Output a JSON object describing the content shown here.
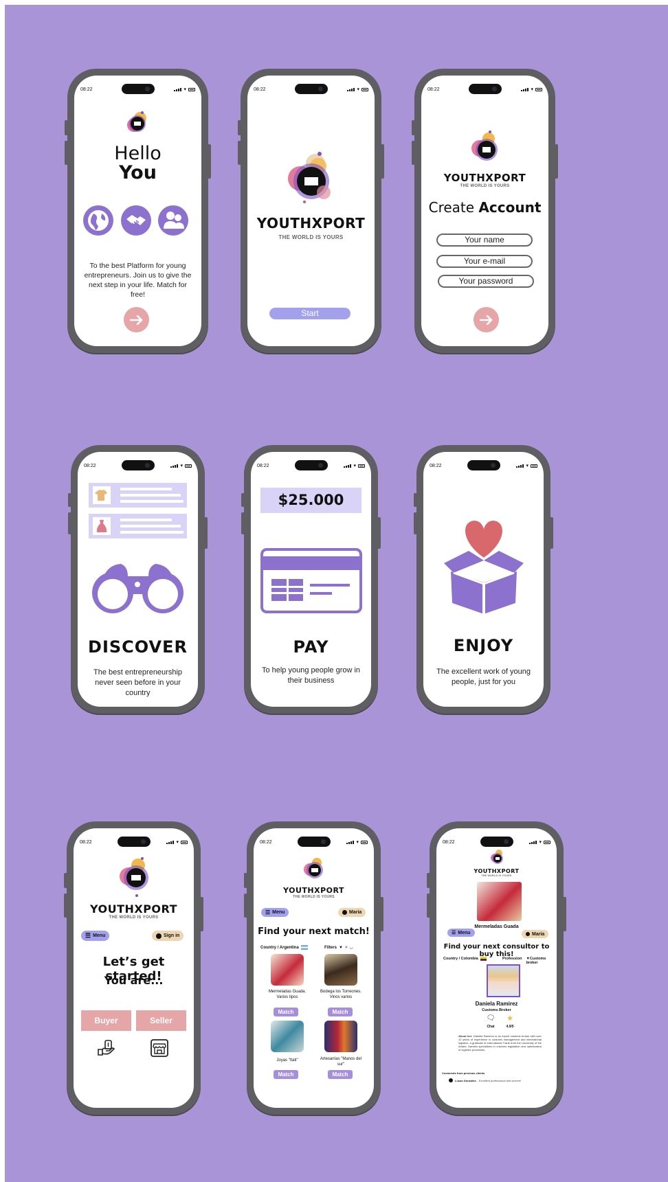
{
  "status_time": "08:22",
  "colors": {
    "background": "#a994d8",
    "purple": "#8d71cf",
    "light_purple": "#d9d4f7",
    "pink": "#e6a5a7",
    "gold": "#edd6b1"
  },
  "icons": [
    "logo-icon",
    "globe-icon",
    "handshake-icon",
    "people-icon",
    "arrow-right-icon",
    "tshirt-icon",
    "dress-icon",
    "binoculars-icon",
    "credit-card-icon",
    "heart-box-icon",
    "menu-icon",
    "user-icon",
    "filter-icon",
    "heart-icon",
    "basket-icon",
    "flag-icon",
    "chat-icon",
    "star-icon",
    "hand-money-icon",
    "shop-icon"
  ],
  "screen1": {
    "title_line1": "Hello",
    "title_line2": "You",
    "body": "To the best Platform for young entrepreneurs. Join us to give the next step in your life. Match for free!"
  },
  "screen2": {
    "brand": "YOUTHXPORT",
    "tagline": "THE WORLD IS YOURS",
    "start": "Start"
  },
  "screen3": {
    "brand": "YOUTHXPORT",
    "tagline": "THE WORLD IS YOURS",
    "title_regular": "Create ",
    "title_bold": "Account",
    "name_placeholder": "Your name",
    "email_placeholder": "Your e-mail",
    "password_placeholder": "Your password"
  },
  "screen4": {
    "title": "DISCOVER",
    "body": "The best entrepreneurship never seen before in your country"
  },
  "screen5": {
    "price": "$25.000",
    "title": "PAY",
    "body": "To help young people grow in their business"
  },
  "screen6": {
    "title": "ENJOY",
    "body": "The excellent work of young people, just for you"
  },
  "screen7": {
    "brand": "YOUTHXPORT",
    "tagline": "THE WORLD IS YOURS",
    "menu": "Menu",
    "signin": "Sign in",
    "heading": "Let’s get started!",
    "subheading": "You are...",
    "buyer": "Buyer",
    "seller": "Seller"
  },
  "screen8": {
    "brand": "YOUTHXPORT",
    "tagline": "THE WORLD IS YOURS",
    "menu": "Menu",
    "user": "Maria",
    "heading": "Find your next match!",
    "country": "Country / Argentina",
    "filters": "Filters",
    "products": [
      {
        "name": "Mermeladas Guada. Varios tipos",
        "match": "Match"
      },
      {
        "name": "Bodega los Torreones. Vinos varios",
        "match": "Match"
      },
      {
        "name": "Joyas \"Itati\"",
        "match": "Match"
      },
      {
        "name": "Artesanías \"Manos del sur\"",
        "match": "Match"
      }
    ]
  },
  "screen9": {
    "brand": "YOUTHXPORT",
    "tagline": "THE WORLD IS YOURS",
    "product": "Mermeladas Guada",
    "menu": "Menu",
    "user": "Maria",
    "heading": "Find your next consultor to buy this!",
    "country": "Country / Colombia",
    "profession": "Profession",
    "filter": "Customs broker",
    "consultant_name": "Daniela Ramirez",
    "consultant_role": "Customs Broker",
    "chat": "Chat",
    "rating": "4.9/5",
    "about_label": "About her:",
    "about": "Daniela Ramírez is an expert customs broker with over 10 years of experience in customs management and international logistics. A graduate in International Trade from the University of the Andes, Daniela specializes in customs legislation and optimization of logistics processes.",
    "comments_label": "Comments from previous clients",
    "commenter": "Lucas González:",
    "comment": "Excellent professional and service!"
  }
}
